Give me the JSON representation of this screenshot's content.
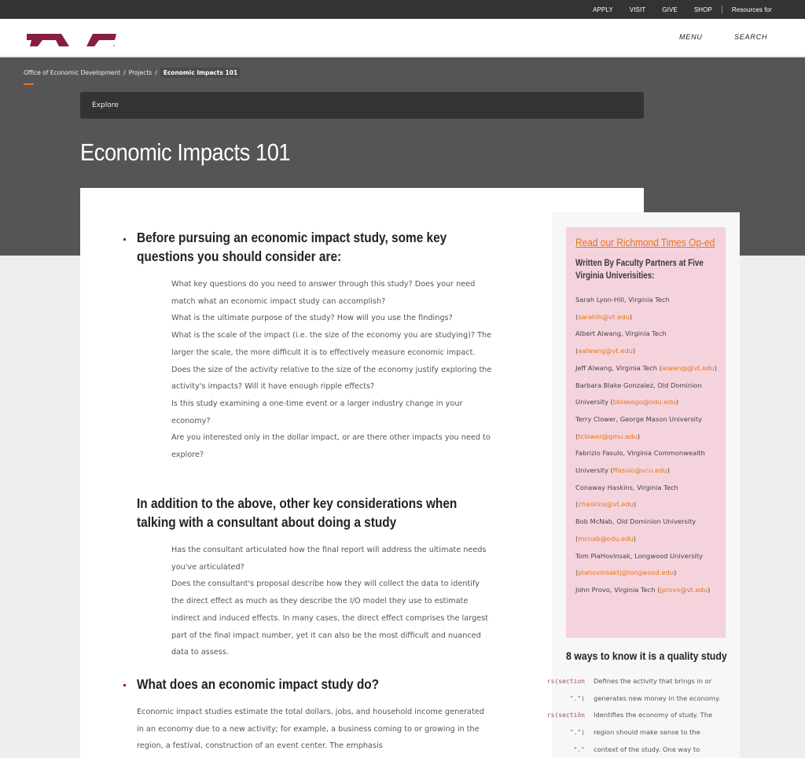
{
  "utility_nav": {
    "links": [
      "APPLY",
      "VISIT",
      "GIVE",
      "SHOP"
    ],
    "resources_label": "Resources for"
  },
  "header": {
    "menu_label": "MENU",
    "search_label": "SEARCH",
    "brand_color": "#861f41"
  },
  "breadcrumb": {
    "items": [
      "Office of Economic Development",
      "Projects"
    ],
    "current": "Economic Impacts 101",
    "separator": "/"
  },
  "explore": {
    "label": "Explore"
  },
  "page_title": "Economic Impacts 101",
  "content": {
    "sections": [
      {
        "heading": "Before pursuing an economic impact study, some key questions you should consider are:",
        "items": [
          "What key questions do you need to answer through this study? Does your need match what an economic impact study can accomplish?",
          "What is the ultimate purpose of the study? How will you use the findings?",
          "What is the scale of the impact (i.e. the size of the economy you are studying)? The larger the scale, the more difficult it is to effectively measure economic impact.",
          "Does the size of the activity relative to the size of the economy justify exploring the activity's impacts? Will it have enough ripple effects?",
          "Is this study examining a one-time event or a larger industry change in your economy?",
          "Are you interested only in the dollar impact, or are there other impacts you need to explore?"
        ]
      },
      {
        "heading": "In addition to the above, other key considerations when talking with a consultant about doing a study",
        "items": [
          "Has the consultant articulated how the final report will address the ultimate needs you've articulated?",
          "Does the consultant's proposal describe how they will collect the data to identify the direct effect as much as they describe the I/O model they use to estimate indirect and induced effects. In many cases, the direct effect comprises the largest part of the final impact number, yet it can also be the most difficult and nuanced data to assess."
        ]
      },
      {
        "heading": "What does an economic impact study do?",
        "paragraph": "Economic impact studies estimate the total dollars, jobs, and household income generated in an economy due to a new activity; for example, a business coming to or growing in the region, a festival, construction of an event center. The emphasis"
      }
    ]
  },
  "sidebar": {
    "oped_title": "Read our Richmond Times Op-ed",
    "oped_subtitle": "Written By Faculty Partners at Five Virginia Univerisities:",
    "authors": [
      {
        "name": "Sarah Lyon-Hill, Virginia Tech",
        "email": "sarahlh@vt.edu"
      },
      {
        "name": "Albert Alwang, Virginia Tech",
        "email": "aalwang@vt.edu"
      },
      {
        "name": "Jeff Alwang, Virginia Tech",
        "email": "alwangj@vt.edu"
      },
      {
        "name": "Barbara Blake Gonzalez, Old Dominion University",
        "email": "bblakego@odu.edu"
      },
      {
        "name": "Terry Clower, George Mason University",
        "email": "tclower@gmu.edu"
      },
      {
        "name": "Fabrizio Fasulo, Virginia Commonwealth University",
        "email": "ffasulo@vcu.edu"
      },
      {
        "name": "Conaway Haskins, Virginia Tech",
        "email": "chaskins@vt.edu"
      },
      {
        "name": "Bob McNab, Old Dominion University",
        "email": "mcnab@odu.edu"
      },
      {
        "name": "Tom PlaHovinsak, Longwood University",
        "email": "plahovinsaktj@longwood.edu"
      },
      {
        "name": "John Provo, Virginia Tech",
        "email": "jprovo@vt.edu"
      }
    ],
    "quality_title": "8 ways to know it is a quality study",
    "quality_rows": [
      {
        "code": "rs(section",
        "text": "Defines the activity that brings in or"
      },
      {
        "code": "\".\")",
        "text": "generates new money in the economy."
      },
      {
        "code": "rs(sectiön",
        "text": "Identifies the economy of study. The"
      },
      {
        "code": "\".\")",
        "text": "region should make sense to the"
      },
      {
        "code": "\".\"",
        "text": "context of the study. One way to"
      }
    ]
  },
  "colors": {
    "accent_orange": "#e5751f",
    "maroon": "#861f41",
    "pink_box": "#f5d3dd",
    "hero_bg": "#555555",
    "utility_bg": "#333333"
  }
}
